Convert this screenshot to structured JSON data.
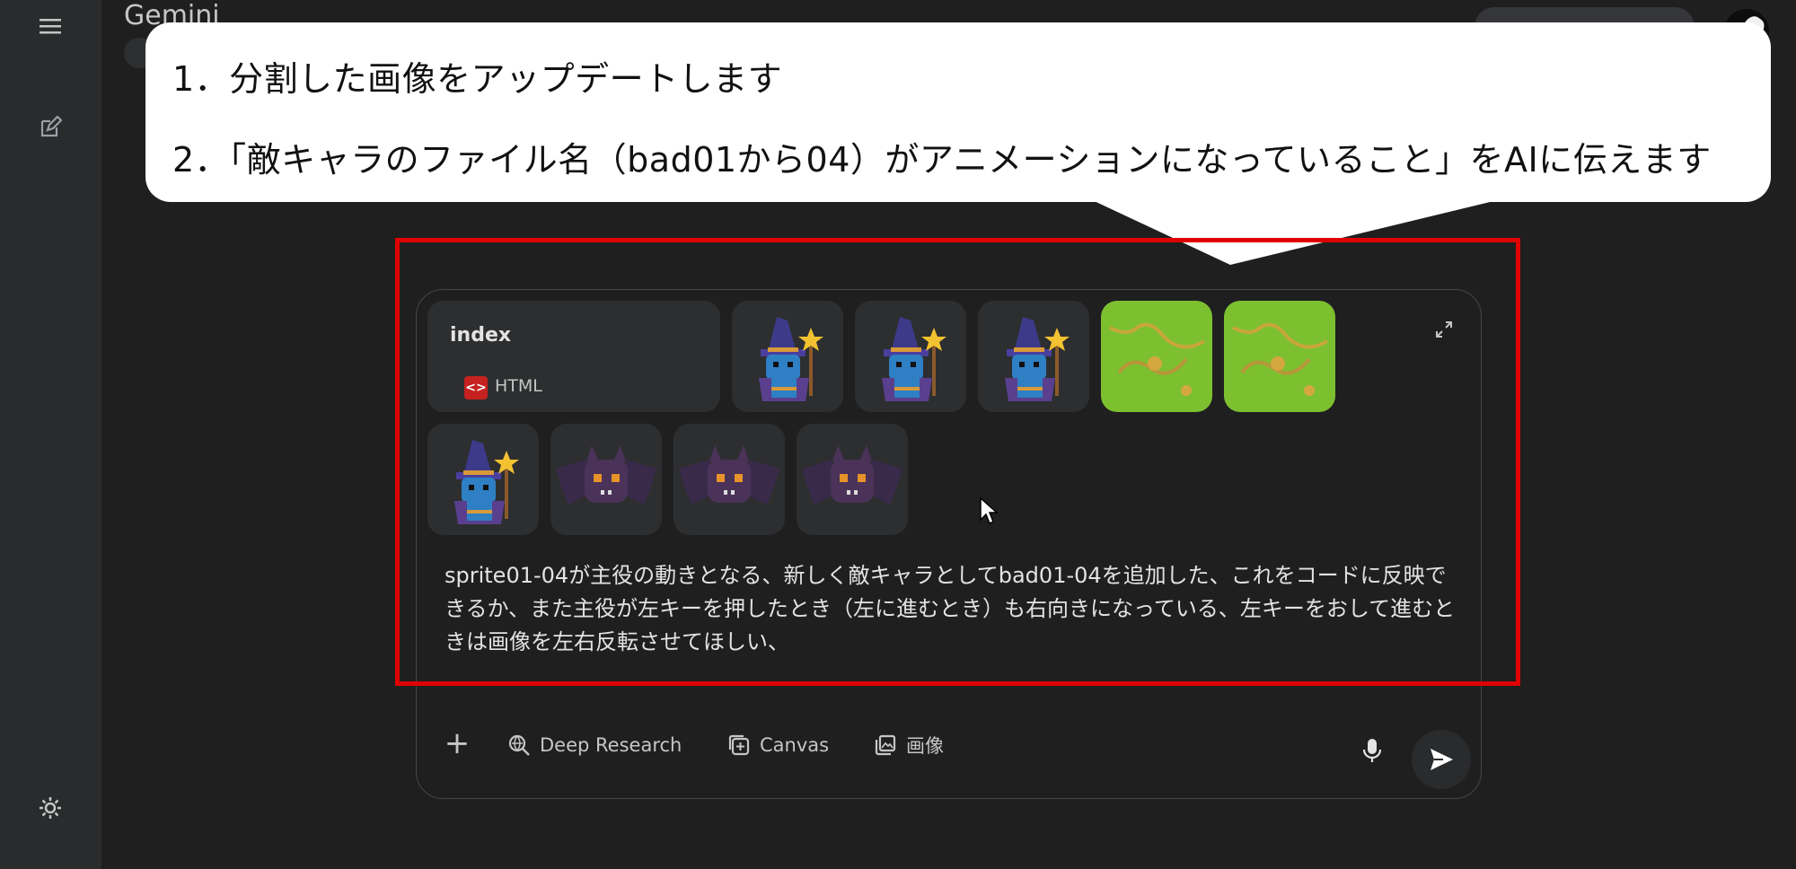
{
  "app": {
    "title": "Gemini"
  },
  "callout": {
    "line1": "1．分割した画像をアップデートします",
    "line2": "2．「敵キャラのファイル名（bad01から04）がアニメーションになっていること」をAIに伝えます"
  },
  "attachment": {
    "name": "index",
    "type": "HTML",
    "type_icon": "code-icon"
  },
  "thumbnails": [
    {
      "kind": "wizard"
    },
    {
      "kind": "wizard"
    },
    {
      "kind": "wizard"
    },
    {
      "kind": "grass"
    },
    {
      "kind": "grass"
    },
    {
      "kind": "wizard"
    },
    {
      "kind": "bat"
    },
    {
      "kind": "bat"
    },
    {
      "kind": "bat"
    }
  ],
  "prompt": "sprite01-04が主役の動きとなる、新しく敵キャラとしてbad01-04を追加した、これをコードに反映できるか、また主役が左キーを押したとき（左に進むとき）も右向きになっている、左キーをおして進むときは画像を左右反転させてほしい、",
  "toolbar": {
    "deep_research": "Deep Research",
    "canvas": "Canvas",
    "image": "画像"
  },
  "colors": {
    "highlight": "#e00000",
    "background": "#1f1f1f",
    "sidebar": "#2a2b2c"
  }
}
